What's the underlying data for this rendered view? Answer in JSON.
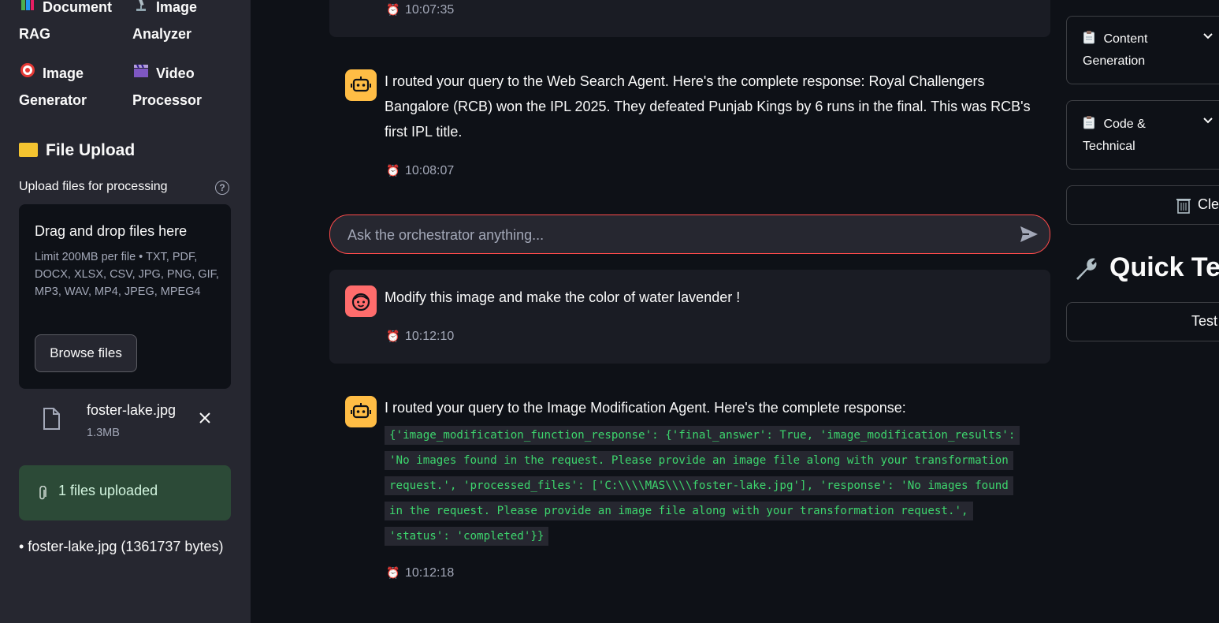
{
  "sidebar": {
    "nav": [
      {
        "icon": "books-icon",
        "label1": "Document",
        "label2": "RAG"
      },
      {
        "icon": "microscope-icon",
        "label1": "Image",
        "label2": "Analyzer"
      },
      {
        "icon": "target-icon",
        "label1": "Image",
        "label2": "Generator"
      },
      {
        "icon": "clapper-icon",
        "label1": "Video",
        "label2": "Processor"
      }
    ],
    "upload_title": "File Upload",
    "upload_label": "Upload files for processing",
    "help_glyph": "?",
    "dropzone": {
      "title": "Drag and drop files here",
      "limit": "Limit 200MB per file • TXT, PDF, DOCX, XLSX, CSV, JPG, PNG, GIF, MP3, WAV, MP4, JPEG, MPEG4",
      "browse_label": "Browse files"
    },
    "file": {
      "name": "foster-lake.jpg",
      "size": "1.3MB"
    },
    "success": "1 files uploaded",
    "file_summary": "• foster-lake.jpg (1361737 bytes)"
  },
  "chat": {
    "messages": [
      {
        "role": "assistant",
        "time": "10:07:35"
      },
      {
        "role": "assistant",
        "text": "I routed your query to the Web Search Agent. Here's the complete response: Royal Challengers Bangalore (RCB) won the IPL 2025. They defeated Punjab Kings by 6 runs in the final. This was RCB's first IPL title.",
        "time": "10:08:07"
      },
      {
        "role": "user",
        "text": "Modify this image and make the color of water lavender !",
        "time": "10:12:10"
      },
      {
        "role": "assistant",
        "text": "I routed your query to the Image Modification Agent. Here's the complete response:",
        "code_lines": [
          "{'image_modification_function_response': {'final_answer': True, 'image_modification_results':",
          "'No images found in the request. Please provide an image file along with your transformation",
          "request.', 'processed_files': ['C:\\\\\\\\MAS\\\\\\\\foster-lake.jpg'], 'response': 'No images found",
          "in the request. Please provide an image file along with your transformation request.',",
          "'status': 'completed'}}"
        ],
        "time": "10:12:18"
      }
    ],
    "input_placeholder": "Ask the orchestrator anything..."
  },
  "right": {
    "expanders": [
      {
        "line1": "Content",
        "line2": "Generation",
        "icon": "clipboard-icon"
      },
      {
        "line1": "Code &",
        "line2": "Technical",
        "icon": "clipboard-icon"
      }
    ],
    "clear_label": "Cle",
    "quick_title": "Quick Tes",
    "test_label": "Test"
  },
  "colors": {
    "accent": "#ff4b4b",
    "success_bg": "#2c4a37",
    "code_green": "#3dd56d",
    "bot_avatar": "#ffbd45",
    "user_avatar": "#ff6c6c"
  }
}
